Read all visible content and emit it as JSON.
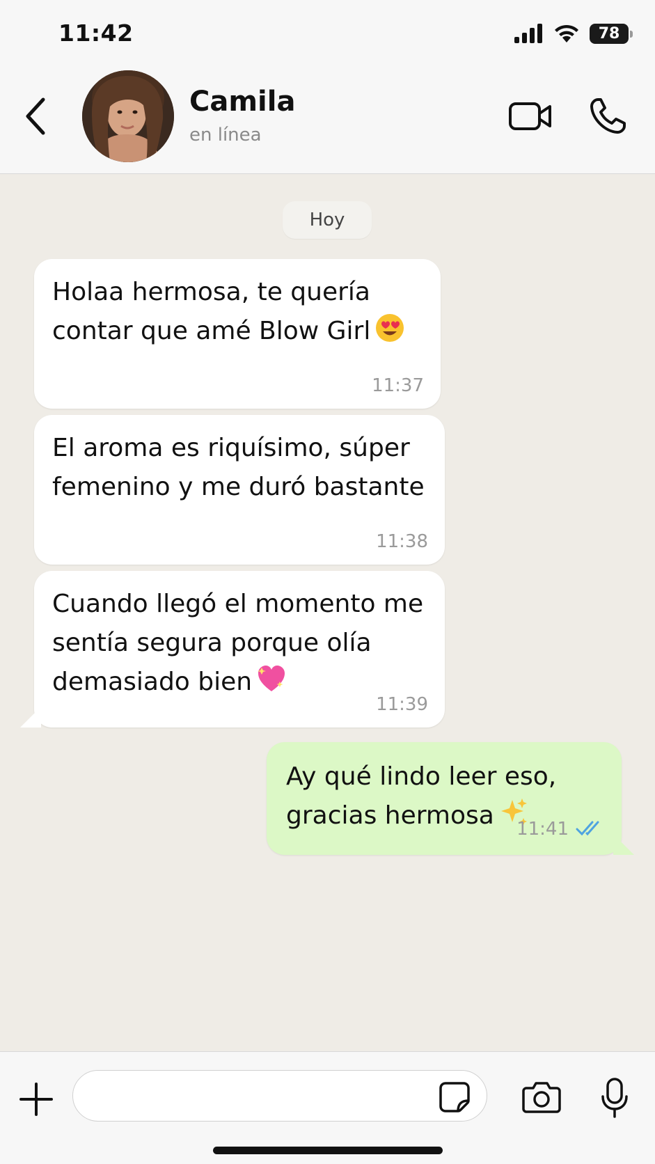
{
  "status_bar": {
    "time": "11:42",
    "battery": "78",
    "icons": [
      "signal-icon",
      "wifi-icon",
      "battery-icon"
    ]
  },
  "header": {
    "back_icon": "chevron-left-icon",
    "contact_name": "Camila",
    "contact_status": "en línea",
    "video_icon": "video-camera-icon",
    "call_icon": "phone-icon"
  },
  "chat": {
    "date_label": "Hoy",
    "messages": [
      {
        "direction": "incoming",
        "text": "Holaa hermosa, te quería\ncontar que amé Blow Girl",
        "emoji": "heart-eyes-emoji",
        "time": "11:37"
      },
      {
        "direction": "incoming",
        "text": "El aroma es riquísimo, súper\nfemenino y me duró bastante",
        "time": "11:38"
      },
      {
        "direction": "incoming",
        "text": "Cuando llegó el momento me\nsentía segura porque olía\ndemasiado bien",
        "emoji": "sparkling-heart-emoji",
        "time": "11:39"
      },
      {
        "direction": "outgoing",
        "text": "Ay qué lindo leer eso,\ngracias hermosa",
        "emoji": "sparkles-emoji",
        "time": "11:41",
        "status": "read",
        "status_icon": "double-check-icon"
      }
    ]
  },
  "input_bar": {
    "plus_icon": "plus-icon",
    "message_value": "",
    "sticker_icon": "sticker-icon",
    "camera_icon": "camera-icon",
    "mic_icon": "microphone-icon"
  },
  "colors": {
    "chat_background": "#efece6",
    "incoming_bubble": "#ffffff",
    "outgoing_bubble": "#dcf8c6",
    "read_ticks": "#4fa3e0"
  }
}
